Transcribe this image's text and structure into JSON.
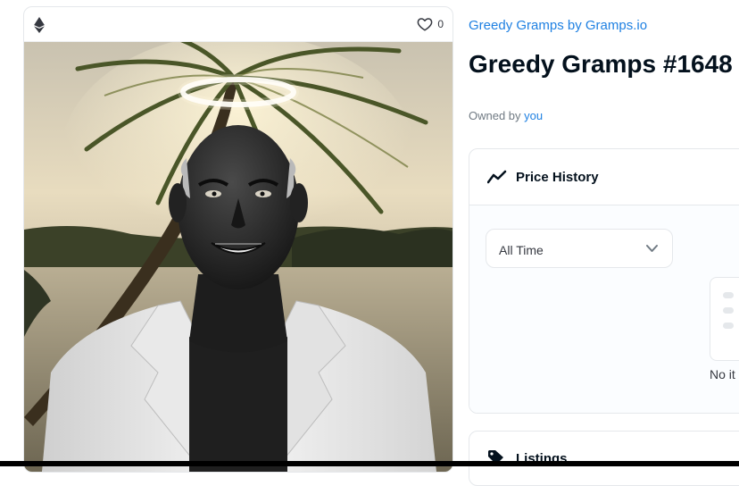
{
  "card": {
    "chain_icon": "ethereum-icon",
    "favorite_icon": "heart-icon",
    "favorite_count": "0"
  },
  "item": {
    "collection": "Greedy Gramps by Gramps.io",
    "title": "Greedy Gramps #1648",
    "owned_by_label": "Owned by",
    "owner": "you"
  },
  "price_history": {
    "icon": "trending-line-icon",
    "title": "Price History",
    "range_selected": "All Time",
    "empty_text": "No it"
  },
  "listings": {
    "icon": "tag-icon",
    "title": "Listings"
  },
  "colors": {
    "accent": "#2081e2",
    "text": "#04111d",
    "muted": "#707a83",
    "border": "#e5e8eb"
  }
}
